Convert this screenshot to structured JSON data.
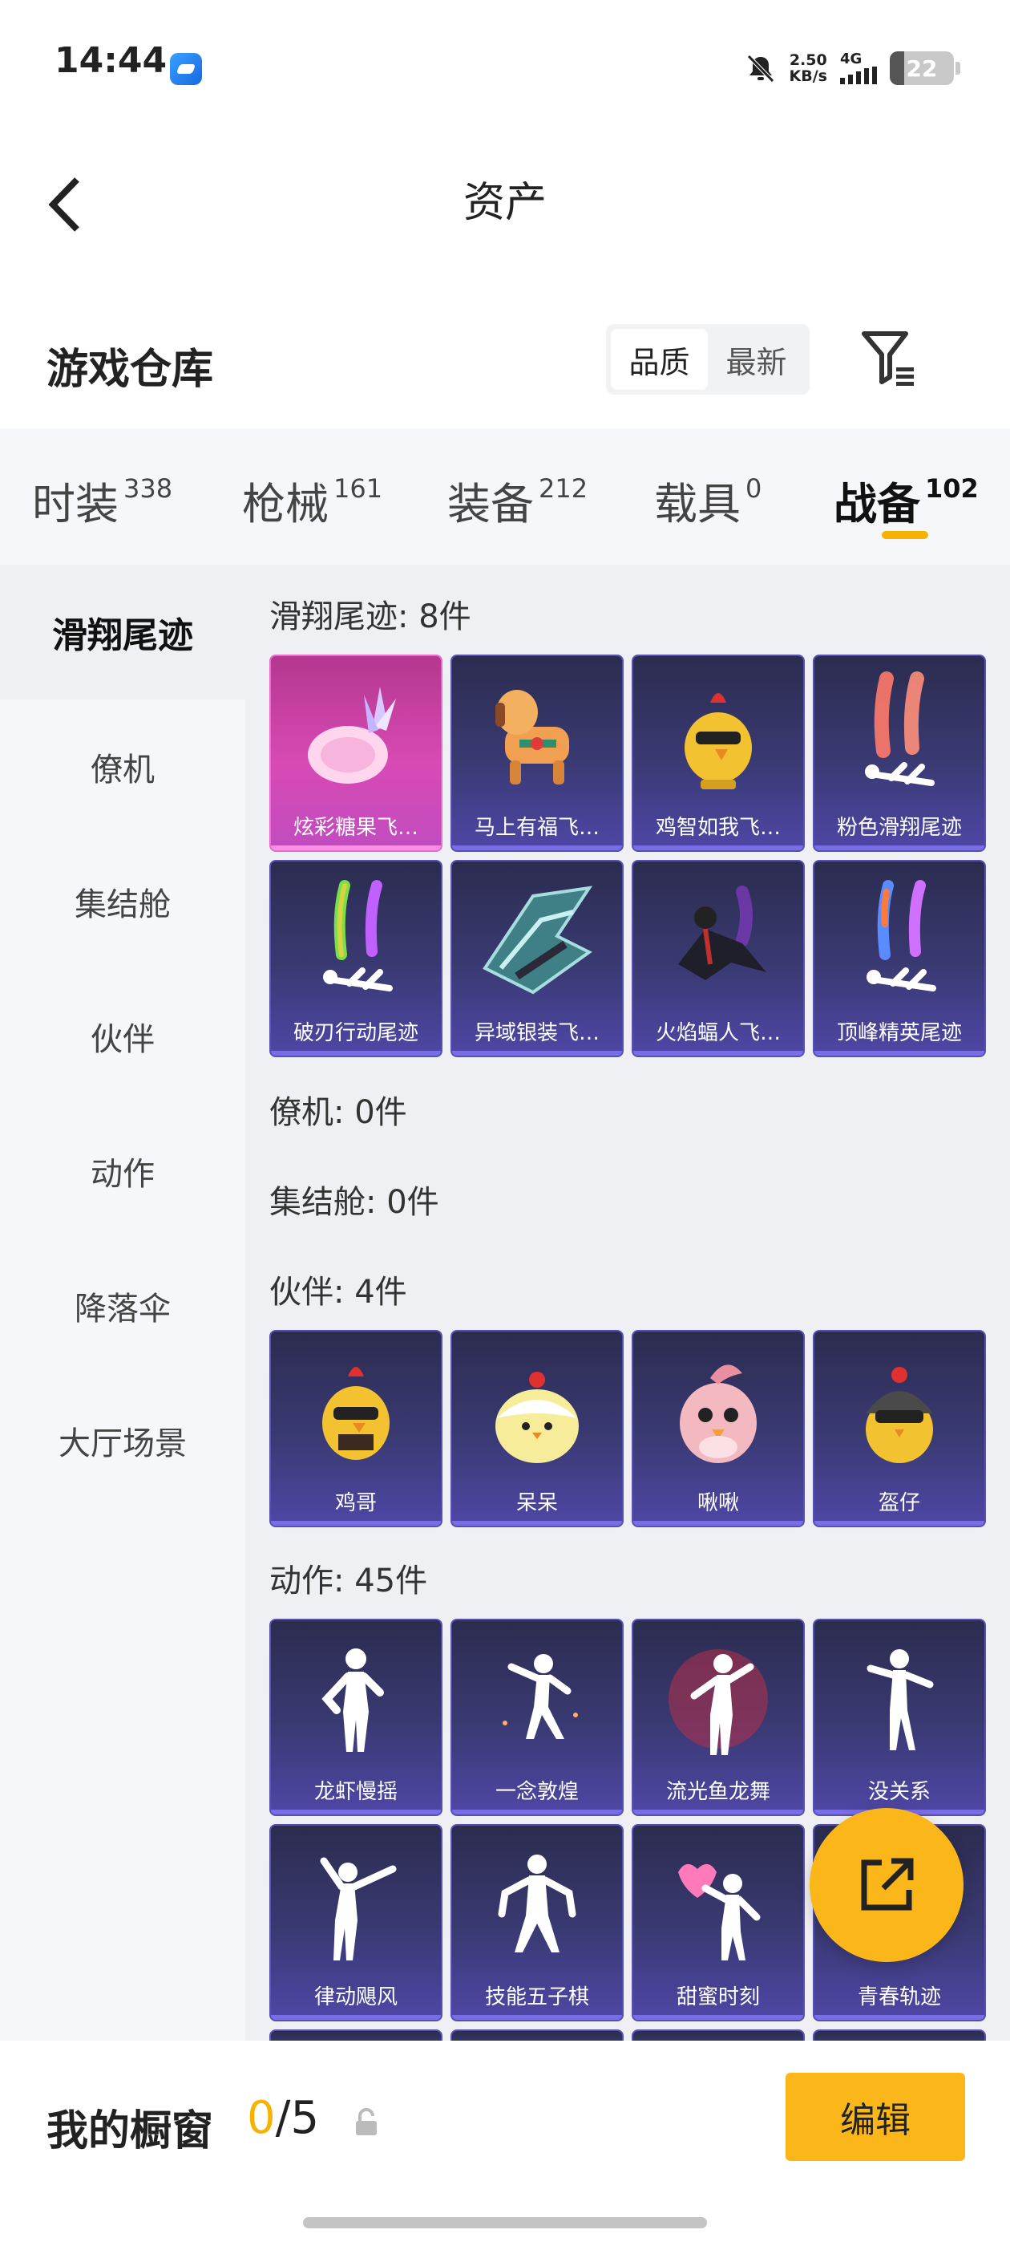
{
  "status_bar": {
    "time": "14:44",
    "net_speed_value": "2.50",
    "net_speed_unit": "KB/s",
    "network": "4G",
    "battery": "22",
    "battery_level": 0.22
  },
  "header": {
    "title": "资产"
  },
  "warehouse": {
    "title": "游戏仓库",
    "sort_options": [
      {
        "label": "品质",
        "active": true
      },
      {
        "label": "最新",
        "active": false
      }
    ]
  },
  "tabs": [
    {
      "label": "时装",
      "count": "338"
    },
    {
      "label": "枪械",
      "count": "161"
    },
    {
      "label": "装备",
      "count": "212"
    },
    {
      "label": "载具",
      "count": "0"
    },
    {
      "label": "战备",
      "count": "102",
      "active": true
    }
  ],
  "sidebar": {
    "items": [
      {
        "label": "滑翔尾迹",
        "active": true
      },
      {
        "label": "僚机"
      },
      {
        "label": "集结舱"
      },
      {
        "label": "伙伴"
      },
      {
        "label": "动作"
      },
      {
        "label": "降落伞"
      },
      {
        "label": "大厅场景"
      }
    ]
  },
  "sections": {
    "glide": {
      "label": "滑翔尾迹: 8件",
      "items": [
        {
          "name": "炫彩糖果飞…",
          "icon": "candy-bag-icon"
        },
        {
          "name": "马上有福飞…",
          "icon": "horse-toy-icon"
        },
        {
          "name": "鸡智如我飞…",
          "icon": "chicken-icon"
        },
        {
          "name": "粉色滑翔尾迹",
          "icon": "pink-trail-icon"
        },
        {
          "name": "破刃行动尾迹",
          "icon": "rainbow-trail-icon"
        },
        {
          "name": "异域银装飞…",
          "icon": "wing-glider-icon"
        },
        {
          "name": "火焰蝠人飞…",
          "icon": "bat-suit-icon"
        },
        {
          "name": "顶峰精英尾迹",
          "icon": "elite-trail-icon"
        }
      ]
    },
    "wingman": {
      "label": "僚机: 0件"
    },
    "pod": {
      "label": "集结舱: 0件"
    },
    "partner": {
      "label": "伙伴: 4件",
      "items": [
        {
          "name": "鸡哥",
          "icon": "chicken-sunglasses-icon"
        },
        {
          "name": "呆呆",
          "icon": "chick-icon"
        },
        {
          "name": "啾啾",
          "icon": "pink-bird-icon"
        },
        {
          "name": "盔仔",
          "icon": "helmet-chick-icon"
        }
      ]
    },
    "emote": {
      "label": "动作: 45件",
      "items": [
        {
          "name": "龙虾慢摇",
          "icon": "dance-pose-icon"
        },
        {
          "name": "一念敦煌",
          "icon": "dance-pose-icon"
        },
        {
          "name": "流光鱼龙舞",
          "icon": "dance-pose-icon"
        },
        {
          "name": "没关系",
          "icon": "dance-pose-icon"
        },
        {
          "name": "律动飓风",
          "icon": "dance-pose-icon"
        },
        {
          "name": "技能五子棋",
          "icon": "dance-pose-icon"
        },
        {
          "name": "甜蜜时刻",
          "icon": "heart-pose-icon"
        },
        {
          "name": "青春轨迹",
          "icon": "dance-pose-icon"
        }
      ]
    }
  },
  "showcase": {
    "label": "我的橱窗",
    "current": "0",
    "separator_total": "/5",
    "edit_label": "编辑"
  },
  "colors": {
    "accent": "#fbb71a",
    "card_purple": "#3a3a74",
    "card_pink": "#d84ab4"
  }
}
